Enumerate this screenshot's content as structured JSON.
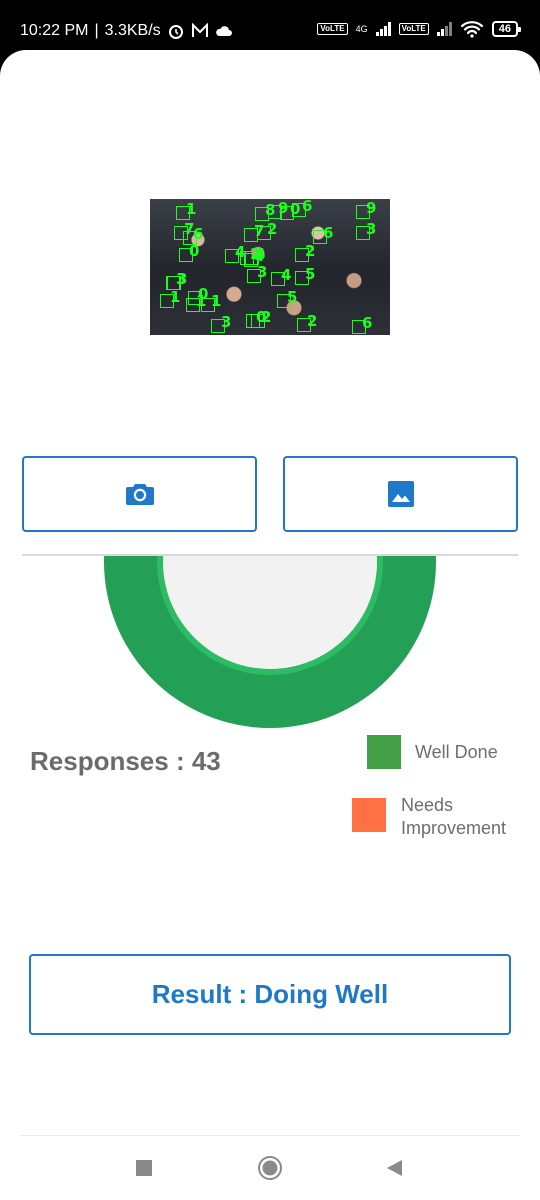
{
  "status_bar": {
    "time": "10:22 PM",
    "speed": "3.3KB/s",
    "network_type": "4G",
    "volte_label": "Vo\nLTE",
    "battery": "46"
  },
  "buttons": {
    "camera_icon": "camera-icon",
    "gallery_icon": "image-icon"
  },
  "detections": {
    "labels": [
      "8",
      "7",
      "4",
      "3",
      "5",
      "3",
      "6",
      "2",
      "2",
      "4",
      "0",
      "6",
      "1",
      "3",
      "2",
      "5",
      "1",
      "0",
      "9",
      "6",
      "4",
      "3",
      "1",
      "2",
      "0",
      "6",
      "0",
      "3",
      "1",
      "2",
      "9",
      "7",
      "4"
    ]
  },
  "chart_data": {
    "type": "pie",
    "title": "",
    "categories": [
      "Well Done",
      "Needs Improvement"
    ],
    "values": [
      43,
      0
    ],
    "colors": [
      "#43a047",
      "#ff7043"
    ]
  },
  "summary": {
    "responses_text": "Responses : 43"
  },
  "legend": [
    {
      "label": "Well Done",
      "color": "#43a047"
    },
    {
      "label": "Needs\nImprovement",
      "color": "#ff7043"
    }
  ],
  "result": {
    "label": "Result : Doing Well"
  },
  "colors": {
    "accent": "#1f79c8",
    "donut_outer": "#23a055",
    "donut_inner_ring": "#2dbb63"
  }
}
